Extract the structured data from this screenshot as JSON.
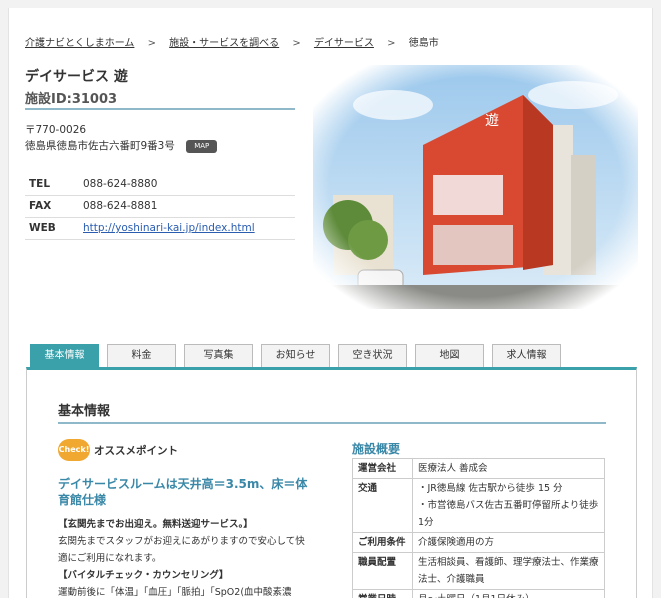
{
  "breadcrumb": {
    "home": "介護ナビとくしまホーム",
    "search": "施設・サービスを調べる",
    "category": "デイサービス",
    "current": "徳島市",
    "sep": ">"
  },
  "facility": {
    "name": "デイサービス 遊",
    "id_label": "施設ID:31003",
    "postal": "〒770-0026",
    "address": "徳島県徳島市佐古六番町9番3号",
    "map_label": "MAP"
  },
  "contact": [
    {
      "label": "TEL",
      "value": "088-624-8880"
    },
    {
      "label": "FAX",
      "value": "088-624-8881"
    },
    {
      "label": "WEB",
      "value": "http://yoshinari-kai.jp/index.html"
    }
  ],
  "tabs": [
    "基本情報",
    "料金",
    "写真集",
    "お知らせ",
    "空き状況",
    "地図",
    "求人情報"
  ],
  "section": {
    "heading": "基本情報",
    "check_badge": "Check!",
    "check_label": "オススメポイント",
    "point_title": "デイサービスルームは天井高＝3.5m、床＝体育館仕様",
    "p1_head": "【玄関先までお出迎え。無料送迎サービス。】",
    "p1_body": "玄関先までスタッフがお迎えにあがりますので安心して快適にご利用になれます。",
    "p2_head": "【バイタルチェック・カウンセリング】",
    "p2_body": "運動前後に「体温」「血圧」「脈拍」「SpO2(血中酸素濃"
  },
  "overview": {
    "title": "施設概要",
    "rows": [
      {
        "k": "運営会社",
        "v": "医療法人 善成会"
      },
      {
        "k": "交通",
        "v": "・JR徳島線 佐古駅から徒歩 15 分\n・市営徳島バス佐古五番町停留所より徒歩1分"
      },
      {
        "k": "ご利用条件",
        "v": "介護保険適用の方"
      },
      {
        "k": "職員配置",
        "v": "生活相談員、看護師、理学療法士、作業療法士、介護職員"
      },
      {
        "k": "営業日時",
        "v": "月～土曜日（1月1日休み）"
      }
    ]
  },
  "colors": {
    "accent": "#3aa0aa",
    "link": "#2a5db0",
    "heading_blue": "#3a88a8",
    "badge": "#f0a830",
    "building": "#d94830"
  },
  "photo": {
    "sign": "遊"
  }
}
